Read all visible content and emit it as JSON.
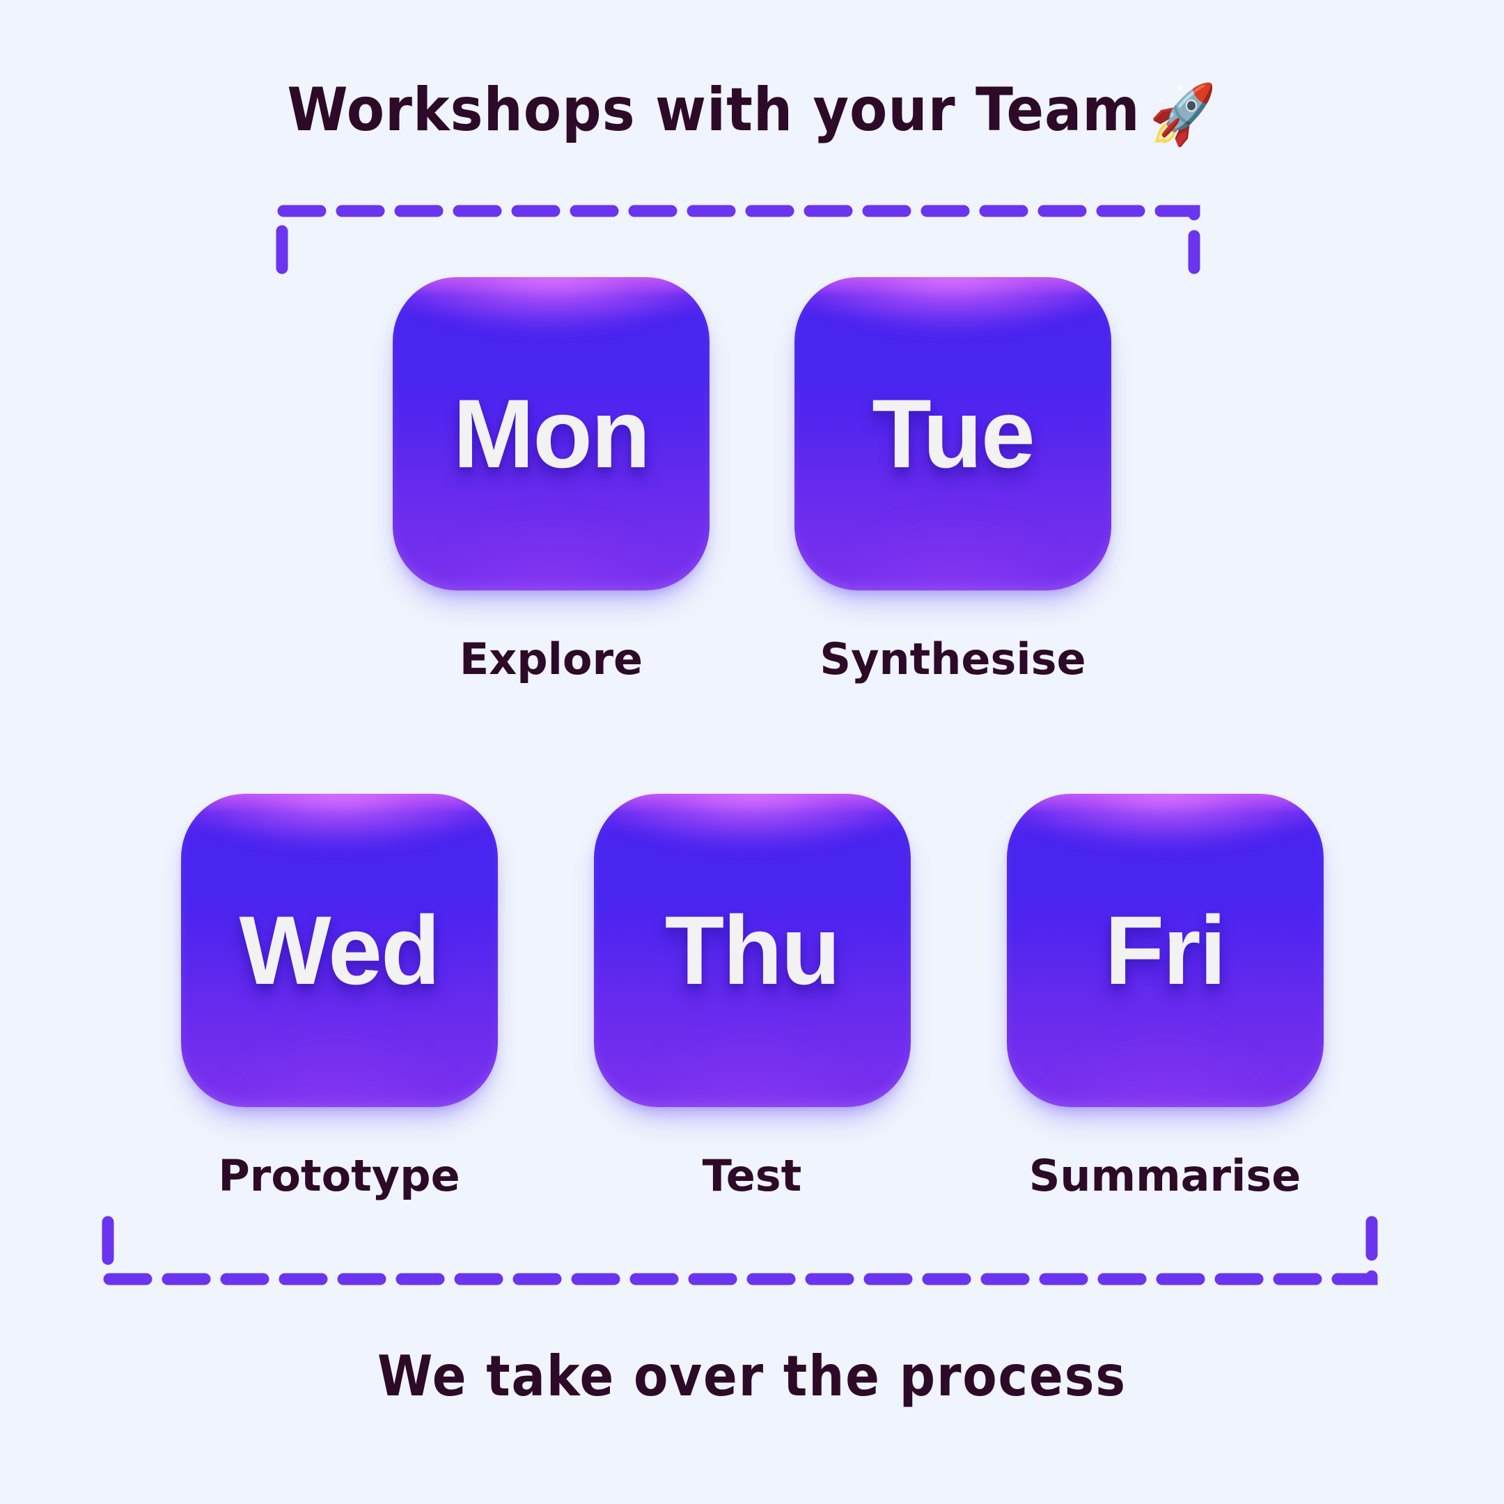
{
  "theme": {
    "background": "#eff4fd",
    "ink": "#2d0a28",
    "accent_dashed": "#6b34ee",
    "card_top": "#c859f7",
    "card_mid": "#4a24ef",
    "card_bottom": "#7a31ef",
    "card_text": "#f2f2f3"
  },
  "header": {
    "title": "Workshops with your Team",
    "emoji": "🚀",
    "emoji_name": "rocket-emoji"
  },
  "footer": {
    "text": "We take over the process"
  },
  "schedule": {
    "row_top": [
      {
        "abbr": "Mon",
        "label": "Explore"
      },
      {
        "abbr": "Tue",
        "label": "Synthesise"
      }
    ],
    "row_bottom": [
      {
        "abbr": "Wed",
        "label": "Prototype"
      },
      {
        "abbr": "Thu",
        "label": "Test"
      },
      {
        "abbr": "Fri",
        "label": "Summarise"
      }
    ]
  },
  "frames": {
    "top_dashed": "dashed-bracket-top",
    "bottom_dashed": "dashed-bracket-bottom"
  }
}
